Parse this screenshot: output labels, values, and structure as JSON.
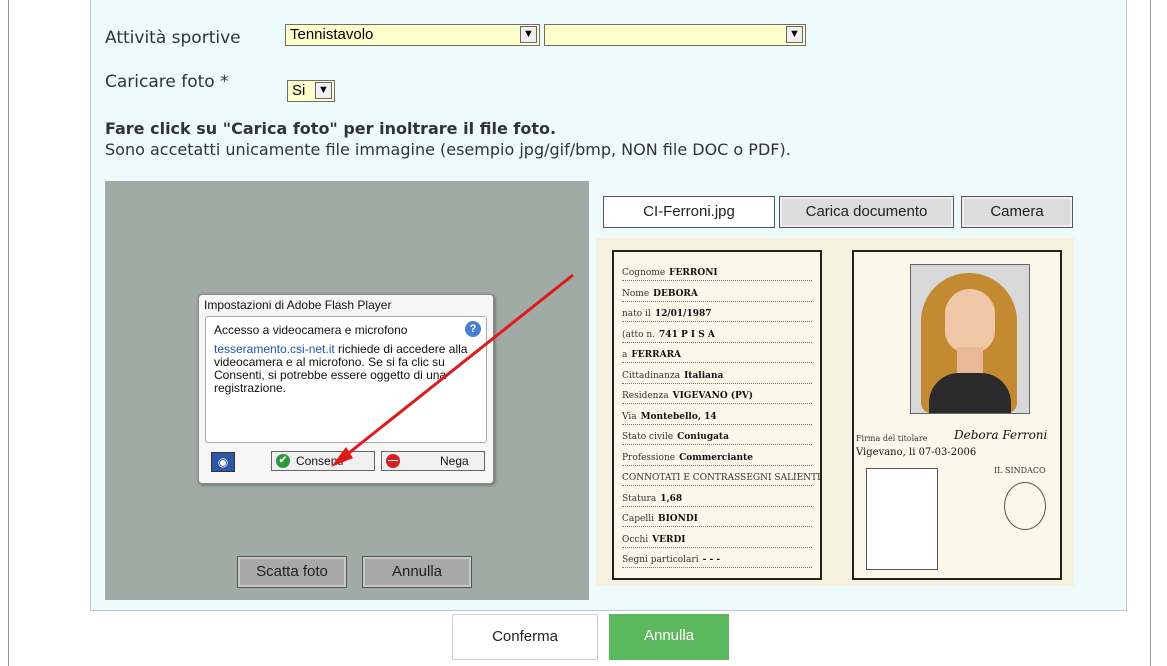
{
  "form": {
    "sport_label": "Attività sportive",
    "sport_value": "Tennistavolo",
    "sport2_value": "",
    "photo_label": "Caricare foto *",
    "photo_value": "Si",
    "instr_bold": "Fare click su \"Carica foto\" per inoltrare il file foto.",
    "instr": "Sono accetatti unicamente file immagine (esempio jpg/gif/bmp, NON file DOC o PDF)."
  },
  "camera": {
    "shoot_label": "Scatta foto",
    "cancel_label": "Annulla"
  },
  "flash_dialog": {
    "title": "Impostazioni di Adobe Flash Player",
    "heading": "Accesso a videocamera e microfono",
    "site": "tesseramento.csi-net.it",
    "message": " richiede di accedere alla videocamera e al microfono. Se si fa clic su Consenti, si potrebbe essere oggetto di una registrazione.",
    "allow_label": "Consenti",
    "deny_label": "Nega"
  },
  "upload": {
    "filename": "CI-Ferroni.jpg",
    "upload_doc_label": "Carica documento",
    "camera_label": "Camera"
  },
  "document": {
    "rows": [
      {
        "label": "Cognome",
        "value": "FERRONI"
      },
      {
        "label": "Nome",
        "value": "DEBORA"
      },
      {
        "label": "nato il",
        "value": "12/01/1987"
      },
      {
        "label": "(atto n.",
        "value": "741   P  I  S  A"
      },
      {
        "label": "a",
        "value": "FERRARA"
      },
      {
        "label": "Cittadinanza",
        "value": "Italiana"
      },
      {
        "label": "Residenza",
        "value": "VIGEVANO (PV)"
      },
      {
        "label": "Via",
        "value": "Montebello, 14"
      },
      {
        "label": "Stato civile",
        "value": "Coniugata"
      },
      {
        "label": "Professione",
        "value": "Commerciante"
      },
      {
        "label": "CONNOTATI E CONTRASSEGNI SALIENTI",
        "value": ""
      },
      {
        "label": "Statura",
        "value": "1,68"
      },
      {
        "label": "Capelli",
        "value": "BIONDI"
      },
      {
        "label": "Occhi",
        "value": "VERDI"
      },
      {
        "label": "Segni particolari",
        "value": "- - -"
      }
    ],
    "signature_label": "Firma del titolare",
    "signature": "Debora Ferroni",
    "place_date": "Vigevano, li 07-03-2006",
    "stamp_title": "IL SINDACO"
  },
  "footer": {
    "confirm_label": "Conferma",
    "cancel_label": "Annulla"
  },
  "colors": {
    "panel_bg": "#eefbfc",
    "select_bg": "#ffffcc",
    "camera_bg": "#9faba4",
    "cancel_green": "#5cb85c",
    "arrow_red": "#e0191b"
  }
}
